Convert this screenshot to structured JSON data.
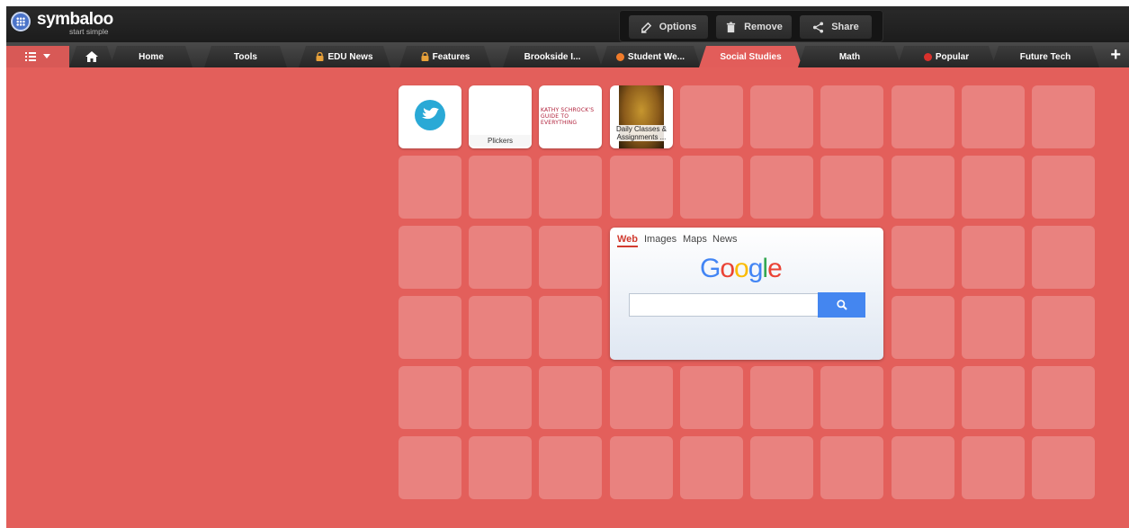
{
  "brand": {
    "name": "symbaloo",
    "tagline": "start simple"
  },
  "actions": {
    "options": "Options",
    "remove": "Remove",
    "share": "Share"
  },
  "tabs": [
    {
      "label": "Home"
    },
    {
      "label": "Tools"
    },
    {
      "label": "EDU News",
      "marker": "lock"
    },
    {
      "label": "Features",
      "marker": "lock"
    },
    {
      "label": "Brookside I..."
    },
    {
      "label": "Student We...",
      "marker": "orange-dot"
    },
    {
      "label": "Social Studies",
      "active": true
    },
    {
      "label": "Math"
    },
    {
      "label": "Popular",
      "marker": "red-dot"
    },
    {
      "label": "Future Tech"
    }
  ],
  "tiles": {
    "plickers": "Plickers",
    "kathy": "KATHY SCHROCK'S GUIDE TO EVERYTHING",
    "daily": "Daily Classes & Assignments ..."
  },
  "google": {
    "tabs": [
      "Web",
      "Images",
      "Maps",
      "News"
    ],
    "logo": "Google",
    "search_value": ""
  },
  "colors": {
    "workspace_bg": "#e35f5b",
    "toolbar": "#1c1c1c",
    "google_blue": "#4486f0"
  }
}
